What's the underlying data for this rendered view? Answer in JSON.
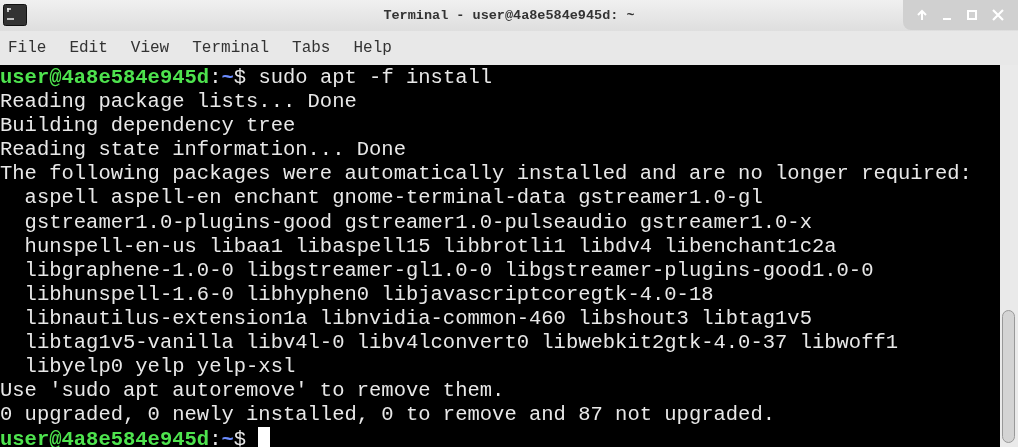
{
  "window": {
    "title": "Terminal - user@4a8e584e945d: ~"
  },
  "menu": [
    "File",
    "Edit",
    "View",
    "Terminal",
    "Tabs",
    "Help"
  ],
  "lines": [
    {
      "kind": "prompt",
      "user_host": "user@4a8e584e945d",
      "separator": ":",
      "path": "~",
      "symbol": "$",
      "command": "sudo apt -f install",
      "cursor": false
    },
    {
      "kind": "output",
      "text": "Reading package lists... Done"
    },
    {
      "kind": "output",
      "text": "Building dependency tree"
    },
    {
      "kind": "output",
      "text": "Reading state information... Done"
    },
    {
      "kind": "output",
      "text": "The following packages were automatically installed and are no longer required:"
    },
    {
      "kind": "output",
      "text": "  aspell aspell-en enchant gnome-terminal-data gstreamer1.0-gl"
    },
    {
      "kind": "output",
      "text": "  gstreamer1.0-plugins-good gstreamer1.0-pulseaudio gstreamer1.0-x"
    },
    {
      "kind": "output",
      "text": "  hunspell-en-us libaa1 libaspell15 libbrotli1 libdv4 libenchant1c2a"
    },
    {
      "kind": "output",
      "text": "  libgraphene-1.0-0 libgstreamer-gl1.0-0 libgstreamer-plugins-good1.0-0"
    },
    {
      "kind": "output",
      "text": "  libhunspell-1.6-0 libhyphen0 libjavascriptcoregtk-4.0-18"
    },
    {
      "kind": "output",
      "text": "  libnautilus-extension1a libnvidia-common-460 libshout3 libtag1v5"
    },
    {
      "kind": "output",
      "text": "  libtag1v5-vanilla libv4l-0 libv4lconvert0 libwebkit2gtk-4.0-37 libwoff1"
    },
    {
      "kind": "output",
      "text": "  libyelp0 yelp yelp-xsl"
    },
    {
      "kind": "output",
      "text": "Use 'sudo apt autoremove' to remove them."
    },
    {
      "kind": "output",
      "text": "0 upgraded, 0 newly installed, 0 to remove and 87 not upgraded."
    },
    {
      "kind": "prompt",
      "user_host": "user@4a8e584e945d",
      "separator": ":",
      "path": "~",
      "symbol": "$",
      "cursor": true
    }
  ]
}
